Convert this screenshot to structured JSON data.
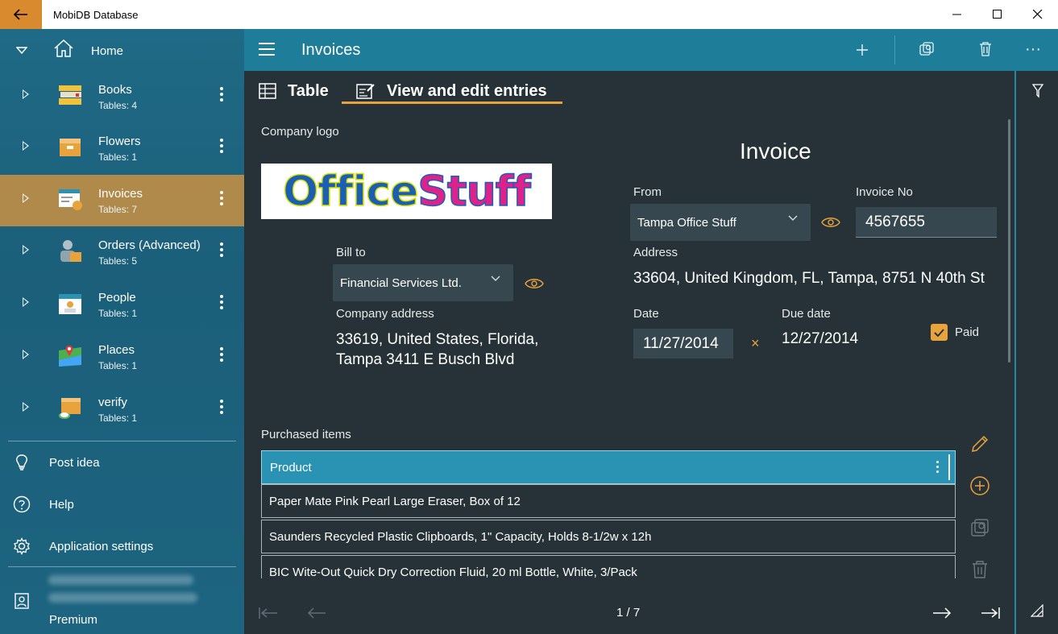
{
  "titlebar": {
    "app_title": "MobiDB Database",
    "back_icon": "arrow-left-icon",
    "minimize": "—",
    "maximize": "☐",
    "close": "✕"
  },
  "sidebar": {
    "home_label": "Home",
    "databases": [
      {
        "name": "Books",
        "tables": "Tables: 4",
        "icon": "books-icon"
      },
      {
        "name": "Flowers",
        "tables": "Tables: 1",
        "icon": "box-icon"
      },
      {
        "name": "Invoices",
        "tables": "Tables: 7",
        "icon": "invoice-icon",
        "active": true
      },
      {
        "name": "Orders (Advanced)",
        "tables": "Tables: 5",
        "icon": "orders-icon"
      },
      {
        "name": "People",
        "tables": "Tables: 1",
        "icon": "calendar-icon"
      },
      {
        "name": "Places",
        "tables": "Tables: 1",
        "icon": "map-icon"
      },
      {
        "name": "verify",
        "tables": "Tables: 1",
        "icon": "box-cloud-icon"
      }
    ],
    "links": {
      "post_idea": "Post idea",
      "help": "Help",
      "settings": "Application settings"
    },
    "account": {
      "plan": "Premium"
    }
  },
  "appbar": {
    "title": "Invoices",
    "add": "+",
    "more": "···"
  },
  "tabs": {
    "table": "Table",
    "view_edit": "View and edit entries"
  },
  "form": {
    "company_logo_label": "Company logo",
    "logo_word_1": "Office",
    "logo_word_2": "Stuff",
    "heading": "Invoice",
    "from_label": "From",
    "from_value": "Tampa Office Stuff",
    "invoice_no_label": "Invoice No",
    "invoice_no_value": "4567655",
    "bill_to_label": "Bill to",
    "bill_to_value": "Financial Services Ltd.",
    "address_label": "Address",
    "address_value": "33604, United Kingdom, FL, Tampa, 8751 N 40th St",
    "company_address_label": "Company address",
    "company_address_line1": "33619, United States, Florida,",
    "company_address_line2": "Tampa 3411 E Busch Blvd",
    "date_label": "Date",
    "date_value": "11/27/2014",
    "clear_date": "×",
    "due_date_label": "Due date",
    "due_date_value": "12/27/2014",
    "paid_label": "Paid",
    "paid_checked": true,
    "purchased_items_label": "Purchased items"
  },
  "grid": {
    "header": "Product",
    "rows": [
      "Paper Mate Pink Pearl Large Eraser, Box of 12",
      "Saunders Recycled Plastic Clipboards, 1\" Capacity, Holds 8-1/2w x 12h",
      "BIC Wite-Out Quick Dry Correction Fluid, 20 ml Bottle, White, 3/Pack"
    ]
  },
  "pager": {
    "text": "1 / 7",
    "first": "⇤",
    "prev": "←",
    "next": "→",
    "last": "⇥"
  },
  "colors": {
    "accent": "#e8a33c",
    "appbar": "#1e7d99",
    "sidebar_active": "#b08a4a",
    "background": "#263238",
    "logo_blue": "#1a5fb4",
    "logo_pink": "#e0218a",
    "logo_outline": "#d9e000"
  }
}
